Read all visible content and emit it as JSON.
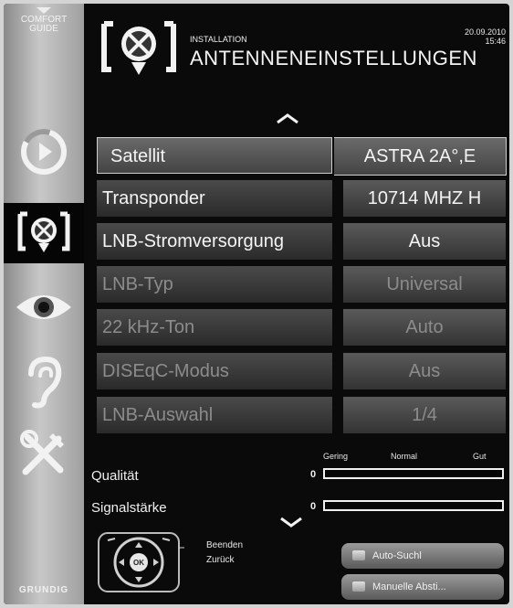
{
  "sidebar": {
    "comfort_line1": "COMFORT",
    "comfort_line2": "GUIDE",
    "items": [
      {
        "icon": "source-icon",
        "active": false
      },
      {
        "icon": "satellite-dish-icon",
        "active": true
      },
      {
        "icon": "eye-icon",
        "active": false
      },
      {
        "icon": "ear-icon",
        "active": false
      },
      {
        "icon": "tools-icon",
        "active": false
      }
    ],
    "brand": "GRUNDIG"
  },
  "header": {
    "icon": "satellite-dish-icon",
    "section": "INSTALLATION",
    "title": "ANTENNENEINSTELLUNGEN",
    "date": "20.09.2010",
    "time": "15:46"
  },
  "settings": [
    {
      "label": "Satellit",
      "value": "ASTRA 2A°,E",
      "state": "selected"
    },
    {
      "label": "Transponder",
      "value": "10714 MHZ H",
      "state": "enabled"
    },
    {
      "label": "LNB-Stromversorgung",
      "value": "Aus",
      "state": "enabled"
    },
    {
      "label": "LNB-Typ",
      "value": "Universal",
      "state": "disabled"
    },
    {
      "label": "22 kHz-Ton",
      "value": "Auto",
      "state": "disabled"
    },
    {
      "label": "DISEqC-Modus",
      "value": "Aus",
      "state": "disabled"
    },
    {
      "label": "LNB-Auswahl",
      "value": "1/4",
      "state": "disabled"
    }
  ],
  "meters": {
    "scale": [
      "Gering",
      "Normal",
      "Gut"
    ],
    "quality_label": "Qualität",
    "quality_value": "0",
    "quality_fraction": 0,
    "strength_label": "Signalstärke",
    "strength_value": "0",
    "strength_fraction": 0
  },
  "remote": {
    "ok_label": "OK",
    "exit_label": "Beenden",
    "back_label": "Zurück"
  },
  "buttons": {
    "auto_search": "Auto-Suchl",
    "manual": "Manuelle Absti..."
  },
  "colors": {
    "background": "#0a0a0a",
    "sidebar": "#b4b4b4",
    "text_enabled": "#f4f4f4",
    "text_disabled": "#8c8c8c"
  }
}
